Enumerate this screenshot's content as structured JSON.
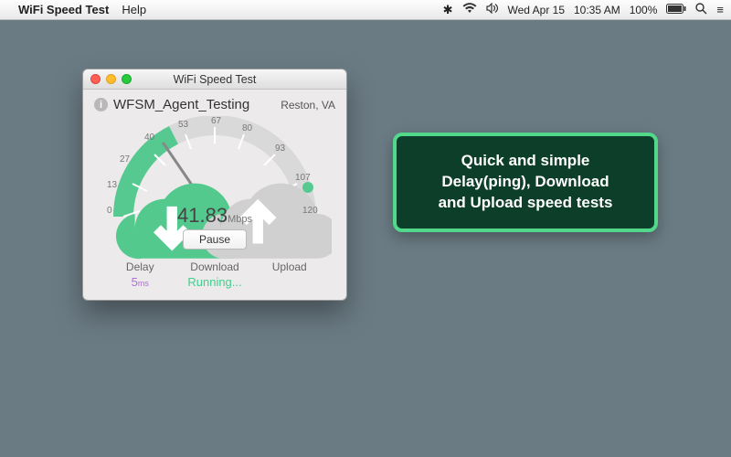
{
  "menubar": {
    "app_name": "WiFi Speed Test",
    "help_label": "Help",
    "date": "Wed Apr 15",
    "time": "10:35 AM",
    "battery": "100%"
  },
  "window": {
    "title": "WiFi Speed Test",
    "ssid": "WFSM_Agent_Testing",
    "location": "Reston, VA",
    "gauge": {
      "ticks": [
        "0",
        "13",
        "27",
        "40",
        "53",
        "67",
        "80",
        "93",
        "107",
        "120"
      ],
      "current_value": "41.83",
      "unit": "Mbps"
    },
    "pause_label": "Pause",
    "stats": {
      "delay_label": "Delay",
      "delay_value": "5",
      "delay_unit": "ms",
      "download_label": "Download",
      "download_value": "Running...",
      "upload_label": "Upload",
      "upload_value": ""
    }
  },
  "callout": {
    "line1": "Quick and simple",
    "line2": "Delay(ping), Download",
    "line3": "and Upload speed tests"
  },
  "icons": {
    "apple": "apple-logo-icon",
    "bluetooth": "bluetooth-icon",
    "wifi": "wifi-icon",
    "volume": "volume-icon",
    "search": "search-icon",
    "list": "list-icon"
  }
}
